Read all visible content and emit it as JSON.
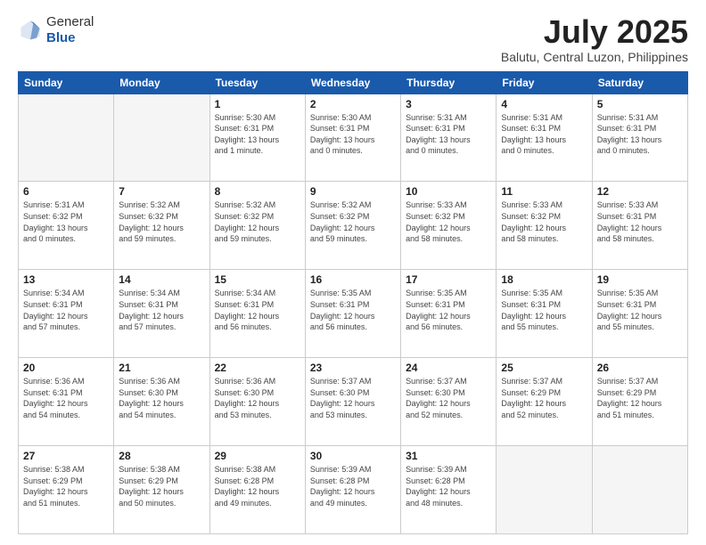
{
  "header": {
    "logo_general": "General",
    "logo_blue": "Blue",
    "month_title": "July 2025",
    "location": "Balutu, Central Luzon, Philippines"
  },
  "days_of_week": [
    "Sunday",
    "Monday",
    "Tuesday",
    "Wednesday",
    "Thursday",
    "Friday",
    "Saturday"
  ],
  "weeks": [
    [
      {
        "day": "",
        "info": ""
      },
      {
        "day": "",
        "info": ""
      },
      {
        "day": "1",
        "info": "Sunrise: 5:30 AM\nSunset: 6:31 PM\nDaylight: 13 hours\nand 1 minute."
      },
      {
        "day": "2",
        "info": "Sunrise: 5:30 AM\nSunset: 6:31 PM\nDaylight: 13 hours\nand 0 minutes."
      },
      {
        "day": "3",
        "info": "Sunrise: 5:31 AM\nSunset: 6:31 PM\nDaylight: 13 hours\nand 0 minutes."
      },
      {
        "day": "4",
        "info": "Sunrise: 5:31 AM\nSunset: 6:31 PM\nDaylight: 13 hours\nand 0 minutes."
      },
      {
        "day": "5",
        "info": "Sunrise: 5:31 AM\nSunset: 6:31 PM\nDaylight: 13 hours\nand 0 minutes."
      }
    ],
    [
      {
        "day": "6",
        "info": "Sunrise: 5:31 AM\nSunset: 6:32 PM\nDaylight: 13 hours\nand 0 minutes."
      },
      {
        "day": "7",
        "info": "Sunrise: 5:32 AM\nSunset: 6:32 PM\nDaylight: 12 hours\nand 59 minutes."
      },
      {
        "day": "8",
        "info": "Sunrise: 5:32 AM\nSunset: 6:32 PM\nDaylight: 12 hours\nand 59 minutes."
      },
      {
        "day": "9",
        "info": "Sunrise: 5:32 AM\nSunset: 6:32 PM\nDaylight: 12 hours\nand 59 minutes."
      },
      {
        "day": "10",
        "info": "Sunrise: 5:33 AM\nSunset: 6:32 PM\nDaylight: 12 hours\nand 58 minutes."
      },
      {
        "day": "11",
        "info": "Sunrise: 5:33 AM\nSunset: 6:32 PM\nDaylight: 12 hours\nand 58 minutes."
      },
      {
        "day": "12",
        "info": "Sunrise: 5:33 AM\nSunset: 6:31 PM\nDaylight: 12 hours\nand 58 minutes."
      }
    ],
    [
      {
        "day": "13",
        "info": "Sunrise: 5:34 AM\nSunset: 6:31 PM\nDaylight: 12 hours\nand 57 minutes."
      },
      {
        "day": "14",
        "info": "Sunrise: 5:34 AM\nSunset: 6:31 PM\nDaylight: 12 hours\nand 57 minutes."
      },
      {
        "day": "15",
        "info": "Sunrise: 5:34 AM\nSunset: 6:31 PM\nDaylight: 12 hours\nand 56 minutes."
      },
      {
        "day": "16",
        "info": "Sunrise: 5:35 AM\nSunset: 6:31 PM\nDaylight: 12 hours\nand 56 minutes."
      },
      {
        "day": "17",
        "info": "Sunrise: 5:35 AM\nSunset: 6:31 PM\nDaylight: 12 hours\nand 56 minutes."
      },
      {
        "day": "18",
        "info": "Sunrise: 5:35 AM\nSunset: 6:31 PM\nDaylight: 12 hours\nand 55 minutes."
      },
      {
        "day": "19",
        "info": "Sunrise: 5:35 AM\nSunset: 6:31 PM\nDaylight: 12 hours\nand 55 minutes."
      }
    ],
    [
      {
        "day": "20",
        "info": "Sunrise: 5:36 AM\nSunset: 6:31 PM\nDaylight: 12 hours\nand 54 minutes."
      },
      {
        "day": "21",
        "info": "Sunrise: 5:36 AM\nSunset: 6:30 PM\nDaylight: 12 hours\nand 54 minutes."
      },
      {
        "day": "22",
        "info": "Sunrise: 5:36 AM\nSunset: 6:30 PM\nDaylight: 12 hours\nand 53 minutes."
      },
      {
        "day": "23",
        "info": "Sunrise: 5:37 AM\nSunset: 6:30 PM\nDaylight: 12 hours\nand 53 minutes."
      },
      {
        "day": "24",
        "info": "Sunrise: 5:37 AM\nSunset: 6:30 PM\nDaylight: 12 hours\nand 52 minutes."
      },
      {
        "day": "25",
        "info": "Sunrise: 5:37 AM\nSunset: 6:29 PM\nDaylight: 12 hours\nand 52 minutes."
      },
      {
        "day": "26",
        "info": "Sunrise: 5:37 AM\nSunset: 6:29 PM\nDaylight: 12 hours\nand 51 minutes."
      }
    ],
    [
      {
        "day": "27",
        "info": "Sunrise: 5:38 AM\nSunset: 6:29 PM\nDaylight: 12 hours\nand 51 minutes."
      },
      {
        "day": "28",
        "info": "Sunrise: 5:38 AM\nSunset: 6:29 PM\nDaylight: 12 hours\nand 50 minutes."
      },
      {
        "day": "29",
        "info": "Sunrise: 5:38 AM\nSunset: 6:28 PM\nDaylight: 12 hours\nand 49 minutes."
      },
      {
        "day": "30",
        "info": "Sunrise: 5:39 AM\nSunset: 6:28 PM\nDaylight: 12 hours\nand 49 minutes."
      },
      {
        "day": "31",
        "info": "Sunrise: 5:39 AM\nSunset: 6:28 PM\nDaylight: 12 hours\nand 48 minutes."
      },
      {
        "day": "",
        "info": ""
      },
      {
        "day": "",
        "info": ""
      }
    ]
  ]
}
